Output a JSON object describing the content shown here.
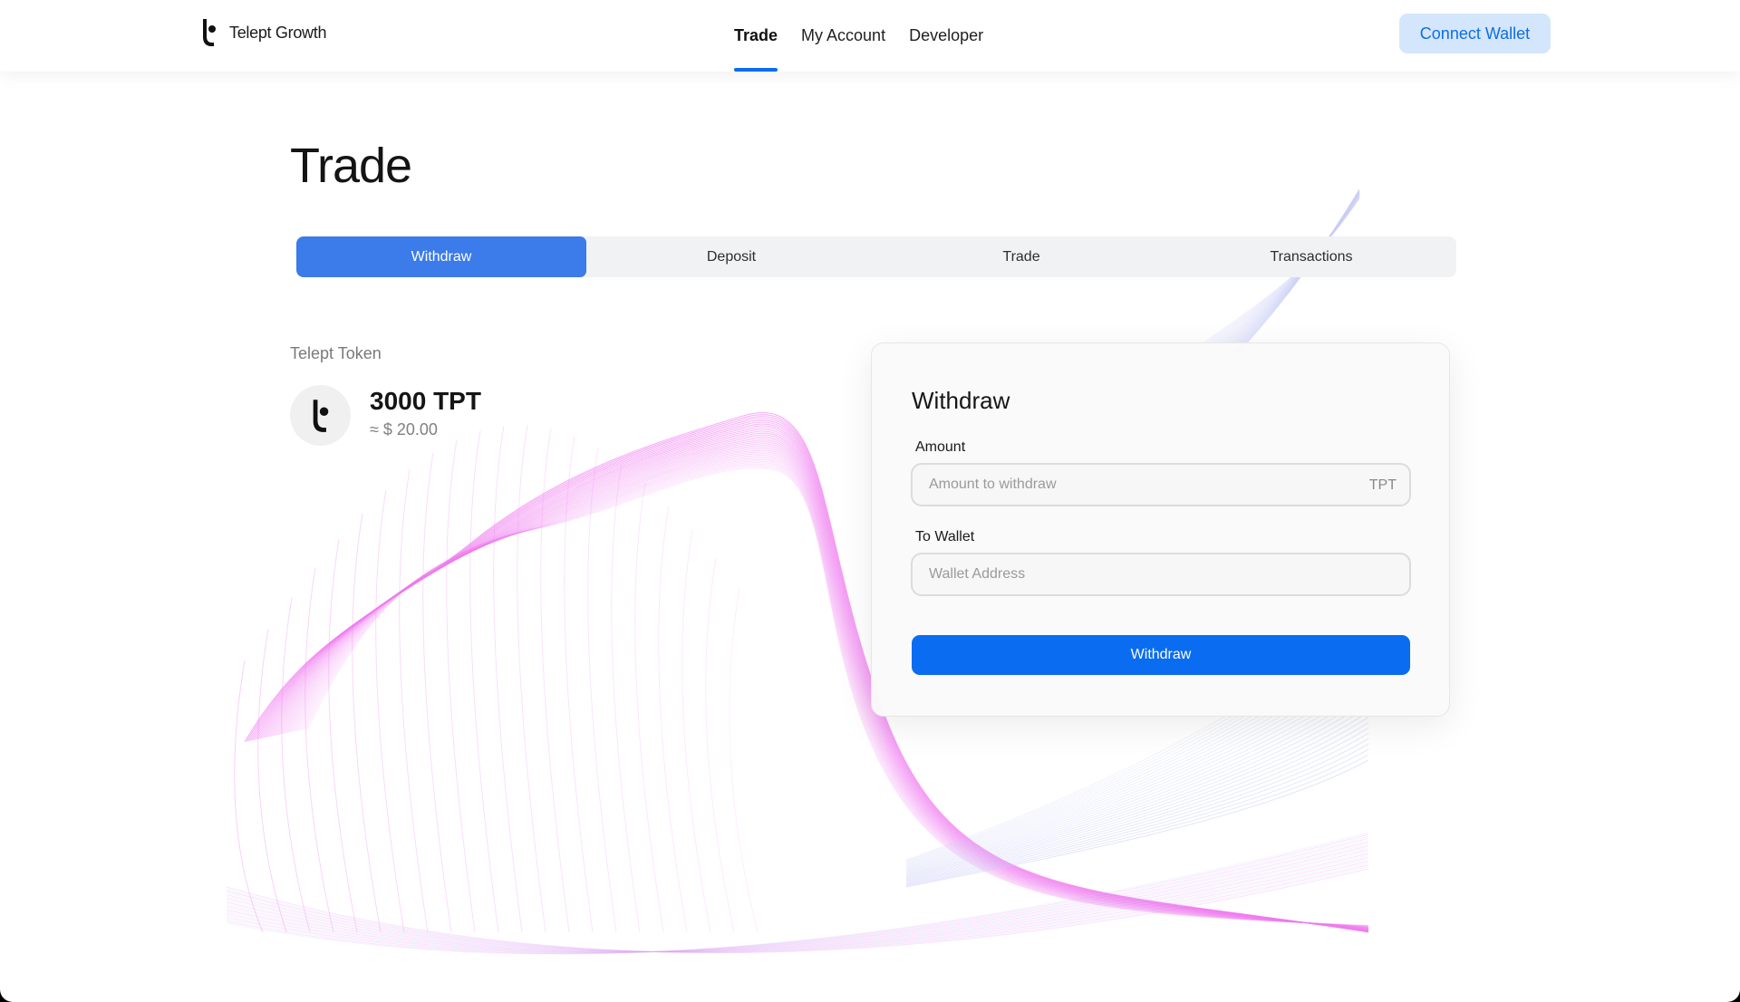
{
  "header": {
    "brand_name": "Telept Growth",
    "nav": [
      {
        "label": "Trade",
        "active": true
      },
      {
        "label": "My Account",
        "active": false
      },
      {
        "label": "Developer",
        "active": false
      }
    ],
    "connect_wallet_label": "Connect Wallet"
  },
  "page_title": "Trade",
  "tabs": [
    {
      "label": "Withdraw",
      "active": true
    },
    {
      "label": "Deposit",
      "active": false
    },
    {
      "label": "Trade",
      "active": false
    },
    {
      "label": "Transactions",
      "active": false
    }
  ],
  "token": {
    "label": "Telept Token",
    "amount": "3000 TPT",
    "usd_value": "≈ $ 20.00",
    "icon": "telept-logo-icon"
  },
  "withdraw_card": {
    "title": "Withdraw",
    "amount_label": "Amount",
    "amount_placeholder": "Amount to withdraw",
    "amount_value": "",
    "amount_suffix": "TPT",
    "wallet_label": "To Wallet",
    "wallet_placeholder": "Wallet Address",
    "wallet_value": "",
    "submit_label": "Withdraw"
  },
  "colors": {
    "accent": "#0a6cf0",
    "tab_active": "#3b7bea",
    "connect_bg": "#d3e6fc",
    "wave_pink": "#f07cf0",
    "wave_lavender": "#c9cdf6"
  }
}
